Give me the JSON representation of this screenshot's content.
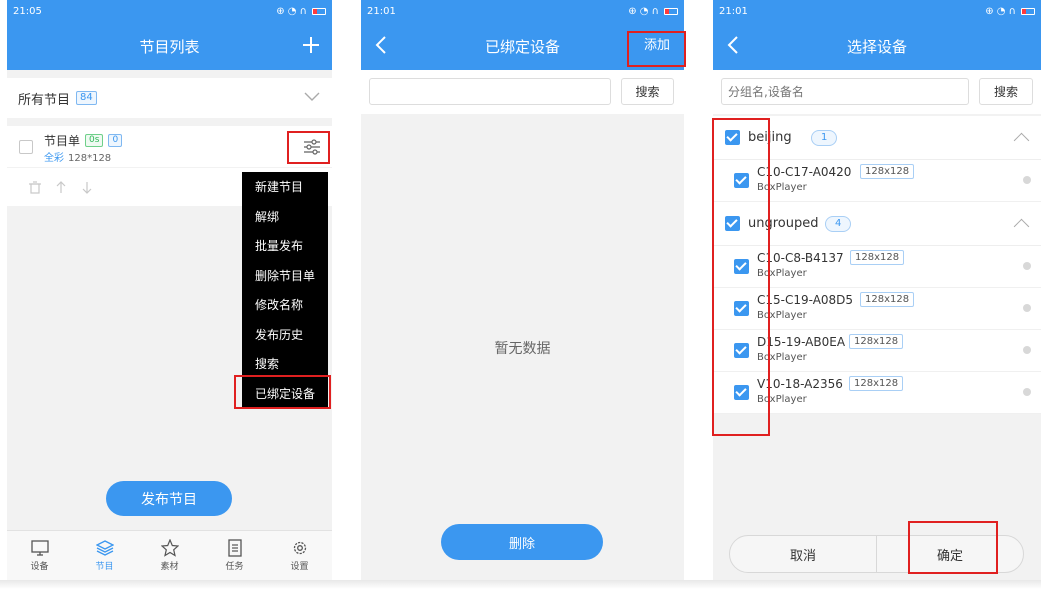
{
  "screen1": {
    "status": {
      "time": "21:05",
      "icons": "⊕ ◔ ∩"
    },
    "title": "节目列表",
    "add_icon": "plus-icon",
    "all_programs": {
      "label": "所有节目",
      "count": "84"
    },
    "program": {
      "name": "节目单",
      "duration": "0s",
      "count": "0",
      "color_mode": "全彩",
      "resolution": "128*128"
    },
    "menu_items": [
      "新建节目",
      "解绑",
      "批量发布",
      "删除节目单",
      "修改名称",
      "发布历史",
      "搜索",
      "已绑定设备"
    ],
    "publish_button": "发布节目",
    "tabs": [
      {
        "label": "设备",
        "icon": "monitor-icon"
      },
      {
        "label": "节目",
        "icon": "layers-icon"
      },
      {
        "label": "素材",
        "icon": "star-icon"
      },
      {
        "label": "任务",
        "icon": "list-icon"
      },
      {
        "label": "设置",
        "icon": "gear-icon"
      }
    ]
  },
  "screen2": {
    "status": {
      "time": "21:01",
      "icons": "⊕ ◔ ∩"
    },
    "title": "已绑定设备",
    "add_label": "添加",
    "search_value": "",
    "search_button": "搜索",
    "empty_text": "暂无数据",
    "delete_button": "删除"
  },
  "screen3": {
    "status": {
      "time": "21:01",
      "icons": "⊕ ◔ ∩"
    },
    "title": "选择设备",
    "search_placeholder": "分组名,设备名",
    "search_button": "搜索",
    "groups": [
      {
        "name": "beijing",
        "count": "1",
        "devices": [
          {
            "id": "C10-C17-A0420",
            "res": "128x128",
            "type": "BoxPlayer"
          }
        ]
      },
      {
        "name": "ungrouped",
        "count": "4",
        "devices": [
          {
            "id": "C10-C8-B4137",
            "res": "128x128",
            "type": "BoxPlayer"
          },
          {
            "id": "C15-C19-A08D5",
            "res": "128x128",
            "type": "BoxPlayer"
          },
          {
            "id": "D15-19-AB0EA",
            "res": "128x128",
            "type": "BoxPlayer"
          },
          {
            "id": "V10-18-A2356",
            "res": "128x128",
            "type": "BoxPlayer"
          }
        ]
      }
    ],
    "cancel_button": "取消",
    "confirm_button": "确定"
  }
}
